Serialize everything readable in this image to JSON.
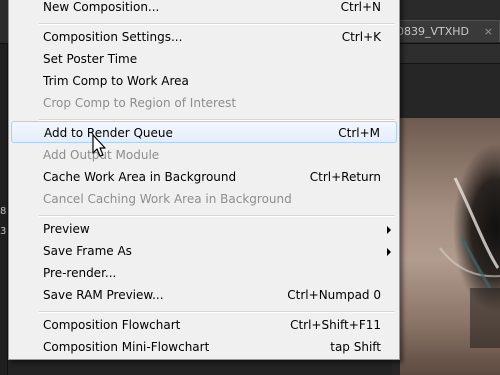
{
  "background": {
    "comp_tab_label": "0839_VTXHD",
    "comp_tab_close": "×",
    "left_numbers": [
      "8",
      "3"
    ]
  },
  "menu": {
    "items": [
      {
        "label": "New Composition...",
        "shortcut": "Ctrl+N",
        "enabled": true
      },
      {
        "label": "Composition Settings...",
        "shortcut": "Ctrl+K",
        "enabled": true
      },
      {
        "label": "Set Poster Time",
        "shortcut": "",
        "enabled": true
      },
      {
        "label": "Trim Comp to Work Area",
        "shortcut": "",
        "enabled": true
      },
      {
        "label": "Crop Comp to Region of Interest",
        "shortcut": "",
        "enabled": false
      },
      {
        "label": "Add to Render Queue",
        "shortcut": "Ctrl+M",
        "enabled": true,
        "highlighted": true
      },
      {
        "label": "Add Output Module",
        "shortcut": "",
        "enabled": false
      },
      {
        "label": "Cache Work Area in Background",
        "shortcut": "Ctrl+Return",
        "enabled": true
      },
      {
        "label": "Cancel Caching Work Area in Background",
        "shortcut": "",
        "enabled": false
      },
      {
        "label": "Preview",
        "shortcut": "",
        "enabled": true,
        "submenu": true
      },
      {
        "label": "Save Frame As",
        "shortcut": "",
        "enabled": true,
        "submenu": true
      },
      {
        "label": "Pre-render...",
        "shortcut": "",
        "enabled": true
      },
      {
        "label": "Save RAM Preview...",
        "shortcut": "Ctrl+Numpad 0",
        "enabled": true
      },
      {
        "label": "Composition Flowchart",
        "shortcut": "Ctrl+Shift+F11",
        "enabled": true
      },
      {
        "label": "Composition Mini-Flowchart",
        "shortcut": "tap Shift",
        "enabled": true
      }
    ]
  },
  "colors": {
    "menu_bg": "#f0f0f0",
    "highlight_border": "#aecff7",
    "disabled_text": "#8d8d8d"
  },
  "icons": {
    "cursor": "arrow-cursor-icon",
    "submenu": "submenu-arrow-icon"
  }
}
